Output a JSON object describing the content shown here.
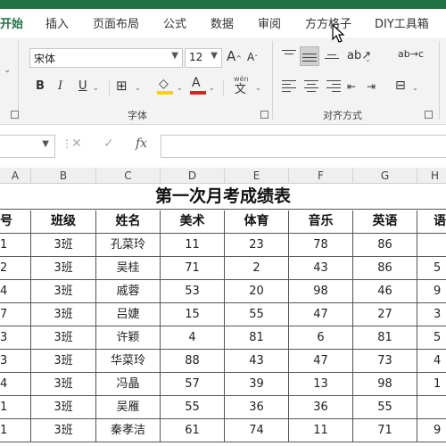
{
  "ribbon_tabs": [
    {
      "label": "开始",
      "active": true
    },
    {
      "label": "插入",
      "active": false
    },
    {
      "label": "页面布局",
      "active": false
    },
    {
      "label": "公式",
      "active": false
    },
    {
      "label": "数据",
      "active": false
    },
    {
      "label": "审阅",
      "active": false
    },
    {
      "label": "方方格子",
      "active": false
    },
    {
      "label": "DIY工具箱",
      "active": false
    }
  ],
  "font_group": {
    "font_name": "宋体",
    "font_size": "12",
    "grow_label": "A",
    "shrink_label": "A",
    "bold": "B",
    "italic": "I",
    "underline": "U",
    "font_color_label": "A",
    "fill_color": "#f5d400",
    "font_color": "#e02020",
    "phonetic_top": "wén",
    "phonetic_bottom": "文",
    "group_label": "字体"
  },
  "alignment_group": {
    "group_label": "对齐方式",
    "wrap_label": "ab→c"
  },
  "formula_bar": {
    "fx_label": "fx",
    "cancel": "✕",
    "confirm": "✓"
  },
  "columns": [
    "A",
    "B",
    "C",
    "D",
    "E",
    "F",
    "G",
    "H"
  ],
  "sheet": {
    "title": "第一次月考成绩表",
    "headers": [
      "号",
      "班级",
      "姓名",
      "美术",
      "体育",
      "音乐",
      "英语",
      "语"
    ],
    "rows": [
      [
        "1",
        "3班",
        "孔菜玲",
        "11",
        "23",
        "78",
        "86",
        ""
      ],
      [
        "2",
        "3班",
        "吴桂",
        "71",
        "2",
        "43",
        "86",
        "5"
      ],
      [
        "4",
        "3班",
        "戚蓉",
        "53",
        "20",
        "98",
        "46",
        "9"
      ],
      [
        "7",
        "3班",
        "吕婕",
        "15",
        "55",
        "47",
        "27",
        "3"
      ],
      [
        "3",
        "3班",
        "许颖",
        "4",
        "81",
        "6",
        "81",
        "5"
      ],
      [
        "3",
        "3班",
        "华菜玲",
        "88",
        "43",
        "47",
        "73",
        "4"
      ],
      [
        "4",
        "3班",
        "冯晶",
        "57",
        "39",
        "13",
        "98",
        "1"
      ],
      [
        "1",
        "3班",
        "吴雁",
        "55",
        "36",
        "36",
        "55",
        ""
      ],
      [
        "1",
        "3班",
        "秦孝洁",
        "61",
        "74",
        "11",
        "71",
        "9"
      ]
    ]
  }
}
